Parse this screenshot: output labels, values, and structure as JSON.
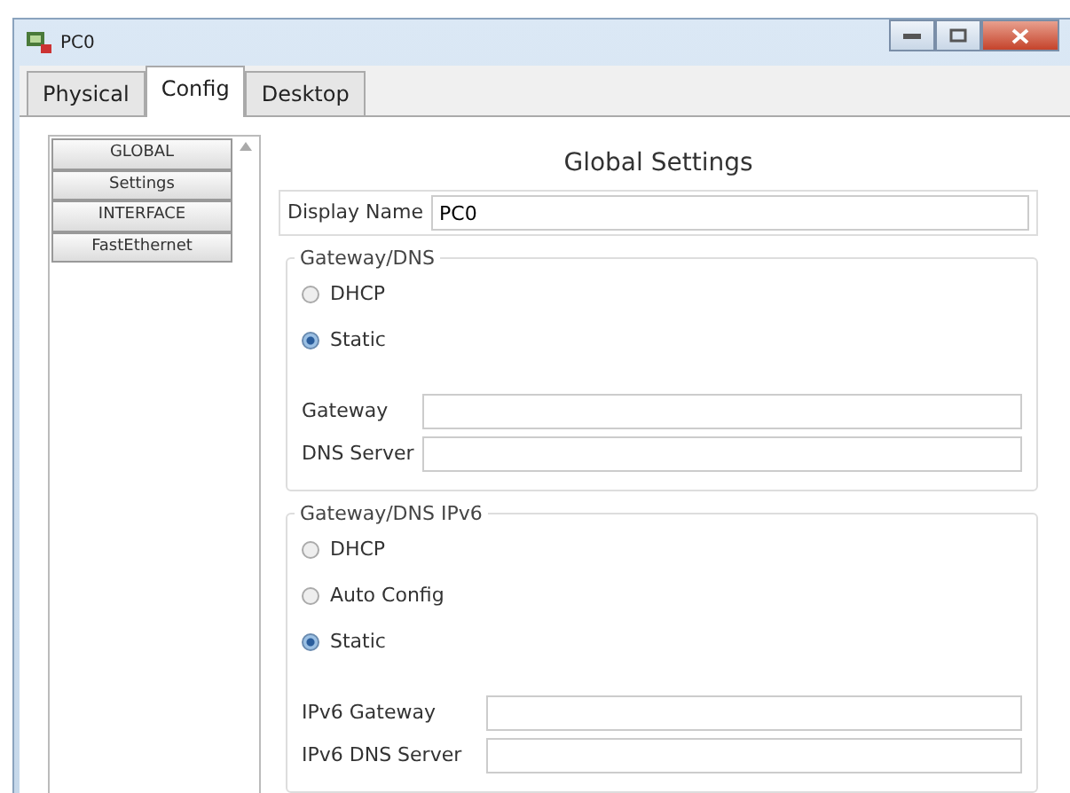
{
  "window": {
    "title": "PC0"
  },
  "tabs": [
    {
      "label": "Physical",
      "selected": false
    },
    {
      "label": "Config",
      "selected": true
    },
    {
      "label": "Desktop",
      "selected": false
    }
  ],
  "sidebar": {
    "items": [
      {
        "label": "GLOBAL",
        "selected": false
      },
      {
        "label": "Settings",
        "selected": false
      },
      {
        "label": "INTERFACE",
        "selected": false
      },
      {
        "label": "FastEthernet",
        "selected": false
      }
    ]
  },
  "heading": "Global Settings",
  "display_name": {
    "label": "Display Name",
    "value": "PC0"
  },
  "sections": [
    {
      "title": "Gateway/DNS",
      "options": [
        {
          "label": "DHCP",
          "selected": false
        },
        {
          "label": "Static",
          "selected": true
        }
      ],
      "fields": [
        {
          "label": "Gateway"
        },
        {
          "label": "DNS Server"
        }
      ]
    },
    {
      "title": "Gateway/DNS IPv6",
      "options": [
        {
          "label": "DHCP",
          "selected": false
        },
        {
          "label": "Auto Config",
          "selected": false
        },
        {
          "label": "Static",
          "selected": true
        }
      ],
      "fields": [
        {
          "label": "IPv6 Gateway"
        },
        {
          "label": "IPv6 DNS Server"
        }
      ]
    }
  ]
}
